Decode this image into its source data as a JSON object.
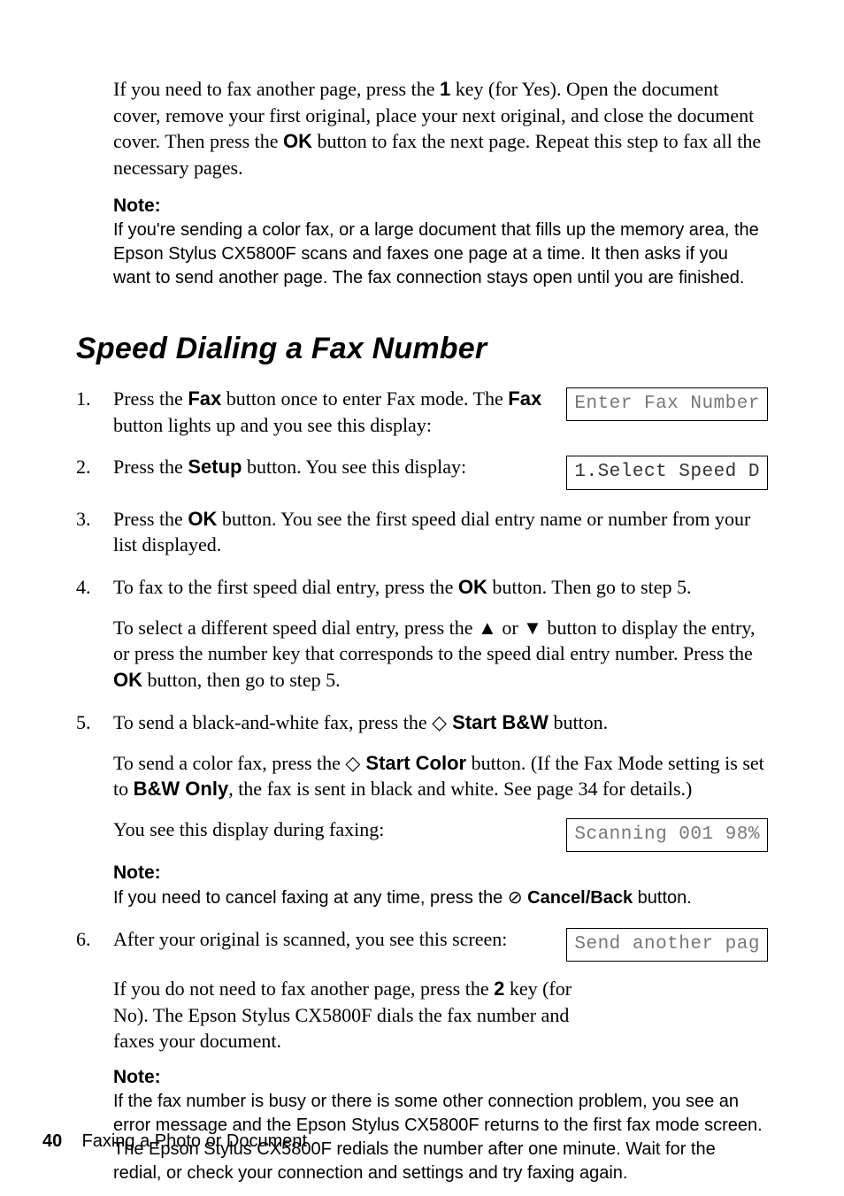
{
  "intro_para": {
    "t1": "If you need to fax another page, press the ",
    "k1": "1",
    "t2": " key (for Yes). Open the document cover, remove your first original, place your next original, and close the document cover. Then press the ",
    "k2": "OK",
    "t3": " button to fax the next page. Repeat this step to fax all the necessary pages."
  },
  "intro_note": {
    "label": "Note:",
    "body": "If you're sending a color fax, or a large document that fills up the memory area, the Epson Stylus CX5800F scans and faxes one page at a time. It then asks if you want to send another page. The fax connection stays open until you are finished."
  },
  "section_title": "Speed Dialing a Fax Number",
  "steps": {
    "s1": {
      "t1": "Press the ",
      "k1": "Fax",
      "t2": " button once to enter Fax mode. The ",
      "k2": "Fax",
      "t3": " button lights up and you see this display:",
      "lcd1": "Enter Fax Number",
      "lcd2": "1.Select Speed D"
    },
    "s2": {
      "t1": "Press the ",
      "k1": "Setup",
      "t2": " button. You see this display:"
    },
    "s3": {
      "t1": "Press the ",
      "k1": "OK",
      "t2": " button. You see the first speed dial entry name or number from your list displayed."
    },
    "s4": {
      "p1a": "To fax to the first speed dial entry, press the ",
      "p1k": "OK",
      "p1b": " button. Then go to step 5.",
      "p2a": "To select a different speed dial entry, press the ",
      "up": "▲",
      "p2b": " or ",
      "down": "▼",
      "p2c": " button to display the entry, or press the number key that corresponds to the speed dial entry number. Press the ",
      "p2k": "OK",
      "p2d": " button, then go to step 5."
    },
    "s5": {
      "p1a": "To send a black-and-white fax, press the ",
      "d1": "◇",
      "p1k": " Start B&W",
      "p1b": " button.",
      "p2a": "To send a color fax, press the ",
      "d2": "◇",
      "p2k": " Start Color",
      "p2b": " button. (If the Fax Mode setting is set to ",
      "p2k2": "B&W Only",
      "p2c": ", the fax is sent in black and white. See page 34 for details.)",
      "p3": "You see this display during faxing:",
      "lcd": "Scanning 001 98%",
      "note_label": "Note:",
      "note_a": "If you need to cancel faxing at any time, press the ",
      "note_sym": "⊘",
      "note_k": " Cancel/Back",
      "note_b": " button."
    },
    "s6": {
      "p1": "After your original is scanned, you see this screen:",
      "lcd": "Send another pag",
      "p2a": "If you do not need to fax another page, press the ",
      "p2k": "2",
      "p2b": " key (for No). The Epson Stylus CX5800F dials the fax number and faxes your document.",
      "note_label": "Note:",
      "note_body": "If the fax number is busy or there is some other connection problem, you see an error message and the Epson Stylus CX5800F returns to the first fax mode screen. The Epson Stylus CX5800F redials the number after one minute. Wait for the redial, or check your connection and settings and try faxing again."
    }
  },
  "footer": {
    "page": "40",
    "title": "Faxing a Photo or Document"
  }
}
